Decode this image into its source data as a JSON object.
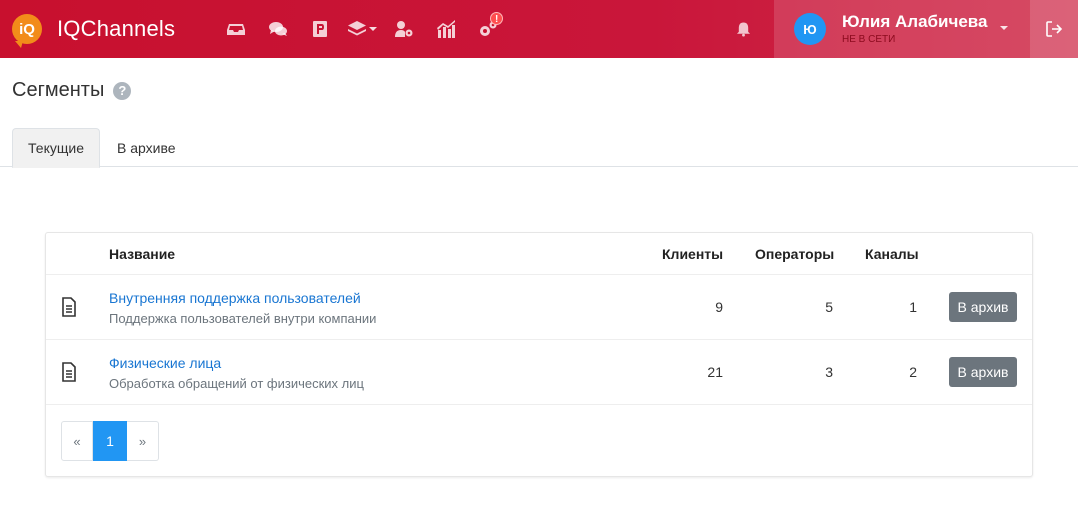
{
  "brand": {
    "logo_text": "iQ",
    "name": "IQChannels"
  },
  "nav": {
    "icons": [
      "inbox-icon",
      "chats-icon",
      "contacts-icon",
      "layers-icon",
      "user-settings-icon",
      "analytics-icon",
      "settings-icon"
    ],
    "settings_alert": "!"
  },
  "user": {
    "avatar_letter": "Ю",
    "name": "Юлия Алабичева",
    "status": "НЕ В СЕТИ"
  },
  "page": {
    "title": "Сегменты",
    "help": "?"
  },
  "tabs": [
    {
      "label": "Текущие",
      "active": true
    },
    {
      "label": "В архиве",
      "active": false
    }
  ],
  "table": {
    "columns": {
      "name": "Название",
      "clients": "Клиенты",
      "operators": "Операторы",
      "channels": "Каналы"
    },
    "rows": [
      {
        "name": "Внутренняя поддержка пользователей",
        "description": "Поддержка пользователей внутри компании",
        "clients": "9",
        "operators": "5",
        "channels": "1",
        "action": "В архив"
      },
      {
        "name": "Физические лица",
        "description": "Обработка обращений от физических лиц",
        "clients": "21",
        "operators": "3",
        "channels": "2",
        "action": "В архив"
      }
    ]
  },
  "pagination": {
    "prev": "«",
    "current": "1",
    "next": "»"
  },
  "colors": {
    "navbar": "#c8102e",
    "accent": "#2196f3",
    "link": "#1976d2",
    "button": "#6c757d"
  }
}
